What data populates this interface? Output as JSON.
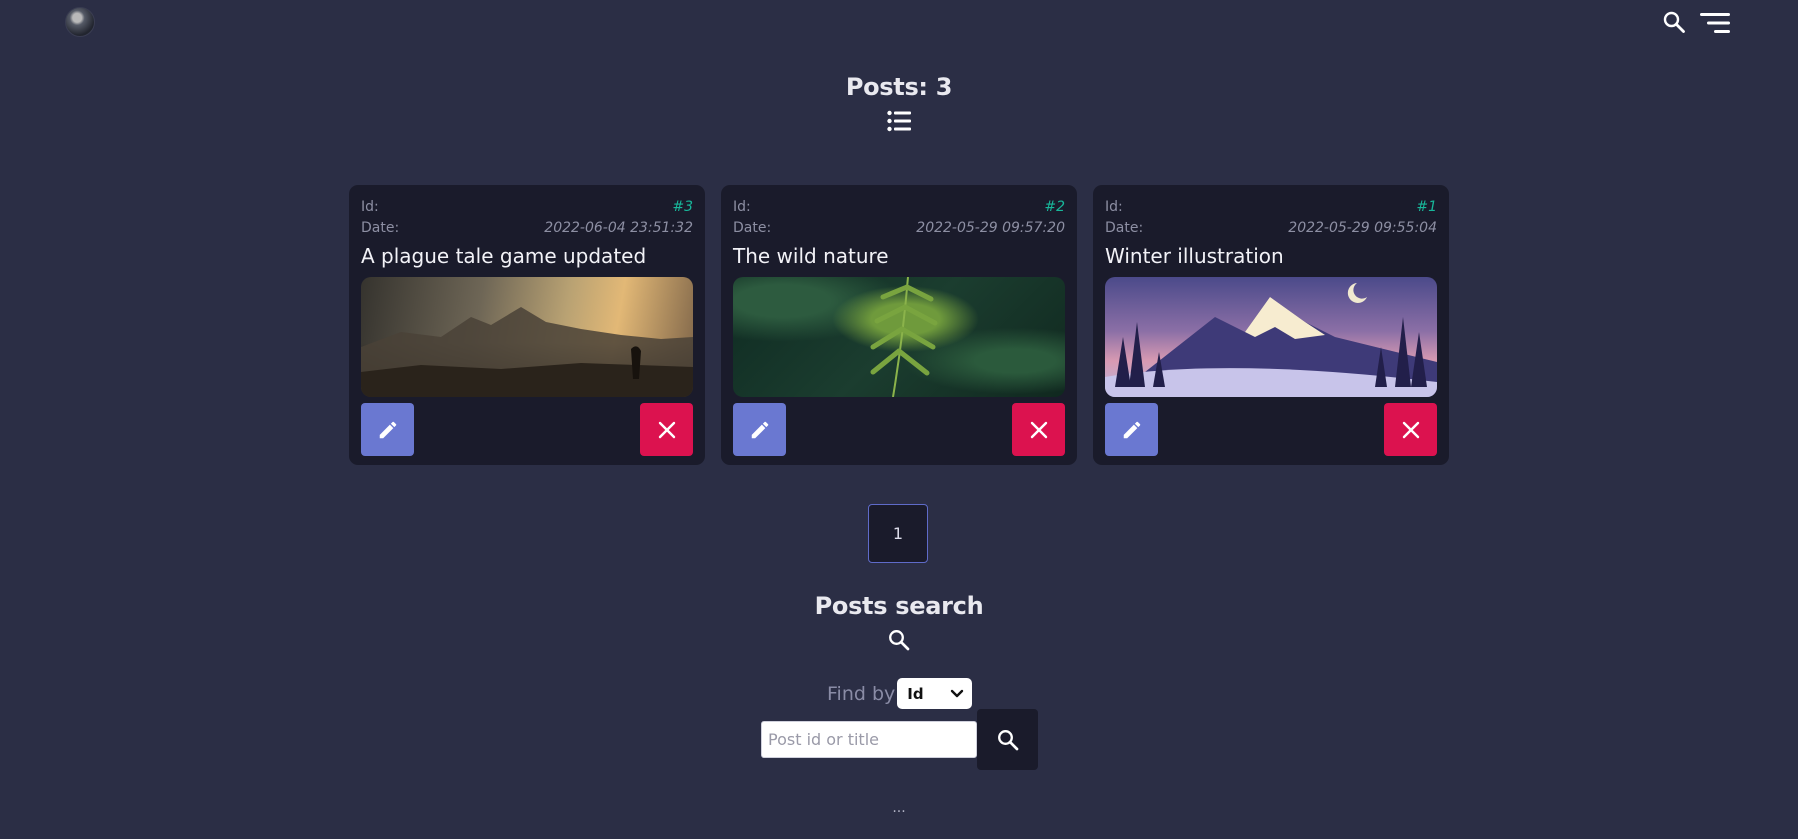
{
  "header": {
    "avatar_icon": "avatar-image",
    "search_icon": "search-icon",
    "menu_icon": "menu-icon"
  },
  "posts_section": {
    "title": "Posts: 3",
    "list_icon": "list-icon"
  },
  "posts": [
    {
      "id_label": "Id:",
      "id_value": "#3",
      "date_label": "Date:",
      "date_value": "2022-06-04 23:51:32",
      "title": "A plague tale game updated",
      "image": "plague-tale-landscape"
    },
    {
      "id_label": "Id:",
      "id_value": "#2",
      "date_label": "Date:",
      "date_value": "2022-05-29 09:57:20",
      "title": "The wild nature",
      "image": "fern-leaves"
    },
    {
      "id_label": "Id:",
      "id_value": "#1",
      "date_label": "Date:",
      "date_value": "2022-05-29 09:55:04",
      "title": "Winter illustration",
      "image": "winter-mountains"
    }
  ],
  "pagination": {
    "current_page": "1"
  },
  "search_section": {
    "title": "Posts search",
    "find_by_label": "Find by",
    "find_by_value": "Id",
    "input_placeholder": "Post id or title",
    "search_icon": "search-icon"
  },
  "footer": {
    "text": "..."
  },
  "colors": {
    "background": "#2b2e45",
    "card": "#1a1b2b",
    "accent_id": "#18b79a",
    "edit_button": "#6a78d1",
    "delete_button": "#dc124f"
  }
}
